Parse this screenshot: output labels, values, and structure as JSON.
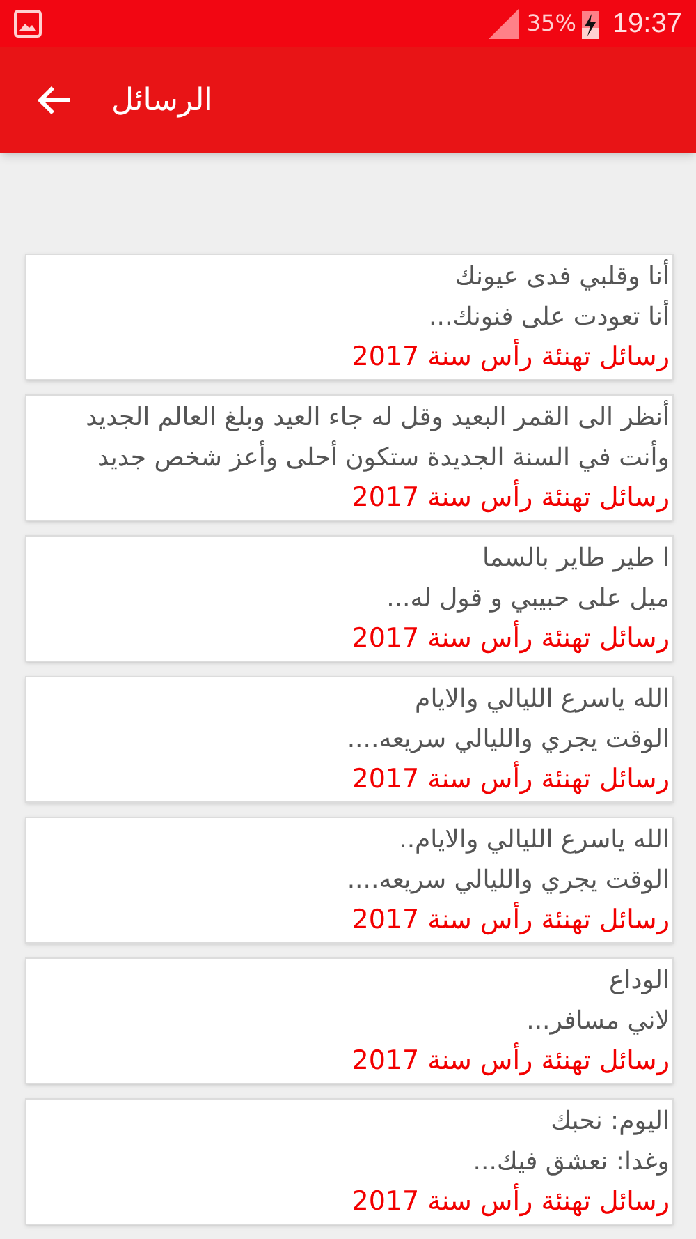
{
  "status_bar": {
    "battery_percent": "35%",
    "time": "19:37"
  },
  "app_bar": {
    "title": "الرسائل"
  },
  "messages": [
    {
      "lines": [
        "أنا وقلبي فدى عيونك",
        "أنا تعودت على فنونك..."
      ],
      "category": "رسائل تهنئة رأس سنة 2017"
    },
    {
      "lines": [
        "أنظر الى القمر البعيد وقل له جاء العيد وبلغ العالم الجديد",
        "وأنت في السنة الجديدة ستكون أحلى وأعز شخص جديد"
      ],
      "category": "رسائل تهنئة رأس سنة 2017"
    },
    {
      "lines": [
        "ا طير طاير بالسما",
        "ميل على حبيبي و قول له..."
      ],
      "category": "رسائل تهنئة رأس سنة 2017"
    },
    {
      "lines": [
        "الله ياسرع الليالي والايام",
        "الوقت يجري والليالي سريعه...."
      ],
      "category": "رسائل تهنئة رأس سنة 2017"
    },
    {
      "lines": [
        "الله ياسرع الليالي والايام..",
        "الوقت يجري والليالي سريعه...."
      ],
      "category": "رسائل تهنئة رأس سنة 2017"
    },
    {
      "lines": [
        "الوداع",
        "لاني مسافر..."
      ],
      "category": "رسائل تهنئة رأس سنة 2017"
    },
    {
      "lines": [
        "اليوم: نحبك",
        "وغدا: نعشق فيك..."
      ],
      "category": "رسائل تهنئة رأس سنة 2017"
    }
  ]
}
